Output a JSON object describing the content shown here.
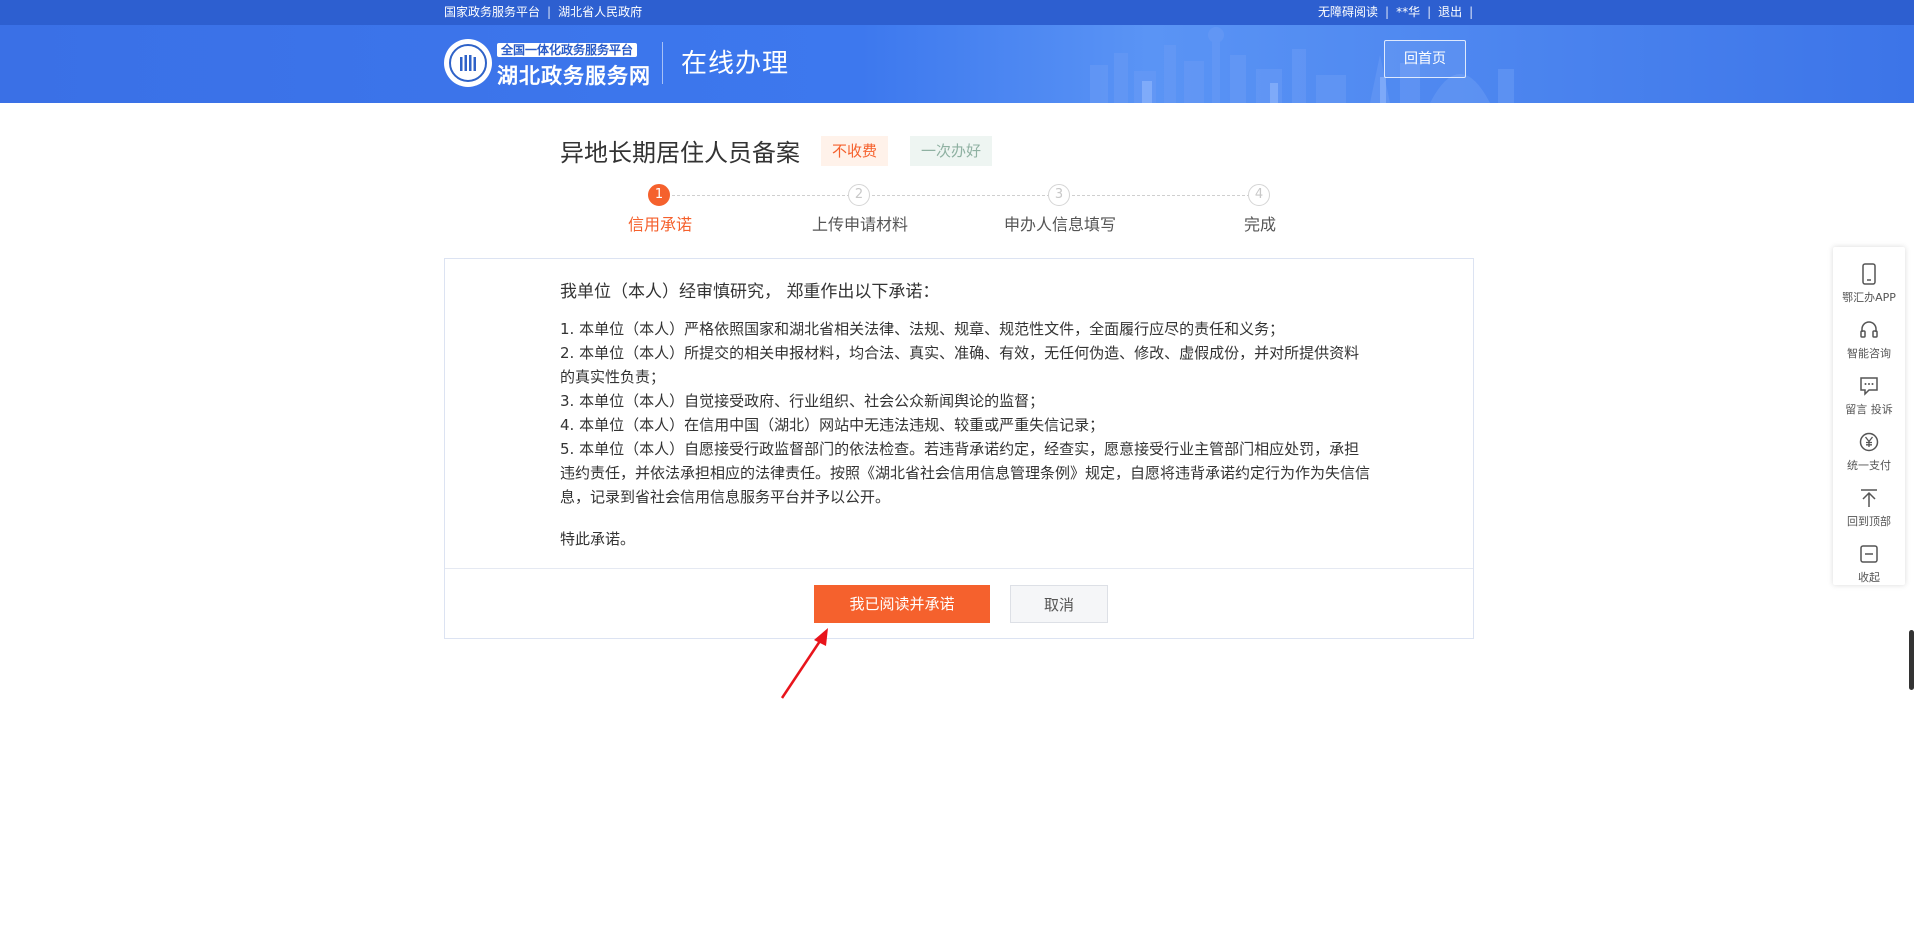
{
  "topbar": {
    "links_left": [
      "国家政务服务平台",
      "湖北省人民政府"
    ],
    "links_right": [
      "无障碍阅读",
      "**华",
      "退出"
    ]
  },
  "header": {
    "logo_small": "全国一体化政务服务平台",
    "logo_big": "湖北政务服务网",
    "page_heading": "在线办理",
    "home_button": "回首页"
  },
  "item": {
    "title": "异地长期居住人员备案",
    "tags": [
      "不收费",
      "一次办好"
    ]
  },
  "steps": [
    {
      "num": "1",
      "label": "信用承诺",
      "active": true
    },
    {
      "num": "2",
      "label": "上传申请材料",
      "active": false
    },
    {
      "num": "3",
      "label": "申办人信息填写",
      "active": false
    },
    {
      "num": "4",
      "label": "完成",
      "active": false
    }
  ],
  "commitment": {
    "heading": "我单位（本人）经审慎研究， 郑重作出以下承诺：",
    "items": [
      "1. 本单位（本人）严格依照国家和湖北省相关法律、法规、规章、规范性文件，全面履行应尽的责任和义务；",
      "2. 本单位（本人）所提交的相关申报材料，均合法、真实、准确、有效，无任何伪造、修改、虚假成份，并对所提供资料的真实性负责；",
      "3. 本单位（本人）自觉接受政府、行业组织、社会公众新闻舆论的监督；",
      "4. 本单位（本人）在信用中国（湖北）网站中无违法违规、较重或严重失信记录；",
      "5. 本单位（本人）自愿接受行政监督部门的依法检查。若违背承诺约定，经查实，愿意接受行业主管部门相应处罚，承担违约责任，并依法承担相应的法律责任。按照《湖北省社会信用信息管理条例》规定，自愿将违背承诺约定行为作为失信信息，记录到省社会信用信息服务平台并予以公开。"
    ],
    "closing": "特此承诺。",
    "agree_button": "我已阅读并承诺",
    "cancel_button": "取消"
  },
  "floatbar": [
    {
      "label": "鄂汇办APP",
      "icon": "phone-icon"
    },
    {
      "label": "智能咨询",
      "icon": "headset-icon"
    },
    {
      "label": "留言 投诉",
      "icon": "message-icon"
    },
    {
      "label": "统一支付",
      "icon": "yen-icon"
    },
    {
      "label": "回到顶部",
      "icon": "back-to-top-icon"
    },
    {
      "label": "收起",
      "icon": "collapse-icon"
    }
  ],
  "colors": {
    "header_blue": "#3a70e6",
    "accent_orange": "#f5612d",
    "annotation_red": "#e8141b"
  }
}
